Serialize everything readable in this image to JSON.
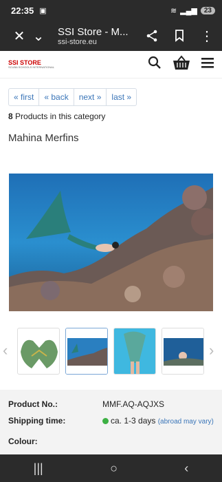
{
  "status": {
    "time": "22:35",
    "battery": "23"
  },
  "browser": {
    "title": "SSI Store - M...",
    "url": "ssi-store.eu"
  },
  "site": {
    "logo": "SSI STORE",
    "logo_sub": "SCUBA SCHOOLS INTERNATIONAL"
  },
  "pager": {
    "first": "« first",
    "back": "« back",
    "next": "next »",
    "last": "last »"
  },
  "category": {
    "count": "8",
    "text": " Products in this category"
  },
  "product": {
    "name": "Mahina Merfins"
  },
  "details": {
    "product_no_label": "Product No.:",
    "product_no": "MMF.AQ-AQJXS",
    "shipping_label": "Shipping time:",
    "shipping_value": "ca. 1-3 days",
    "shipping_note": "(abroad may vary)",
    "colour_label": "Colour:"
  },
  "colors": {
    "bar": "#2b2b2b",
    "link": "#3a75b8",
    "instock": "#3cb043"
  },
  "icons": [
    "close-icon",
    "chevron-down-icon",
    "share-icon",
    "bookmark-icon",
    "more-icon",
    "search-icon",
    "cart-icon",
    "menu-icon"
  ]
}
